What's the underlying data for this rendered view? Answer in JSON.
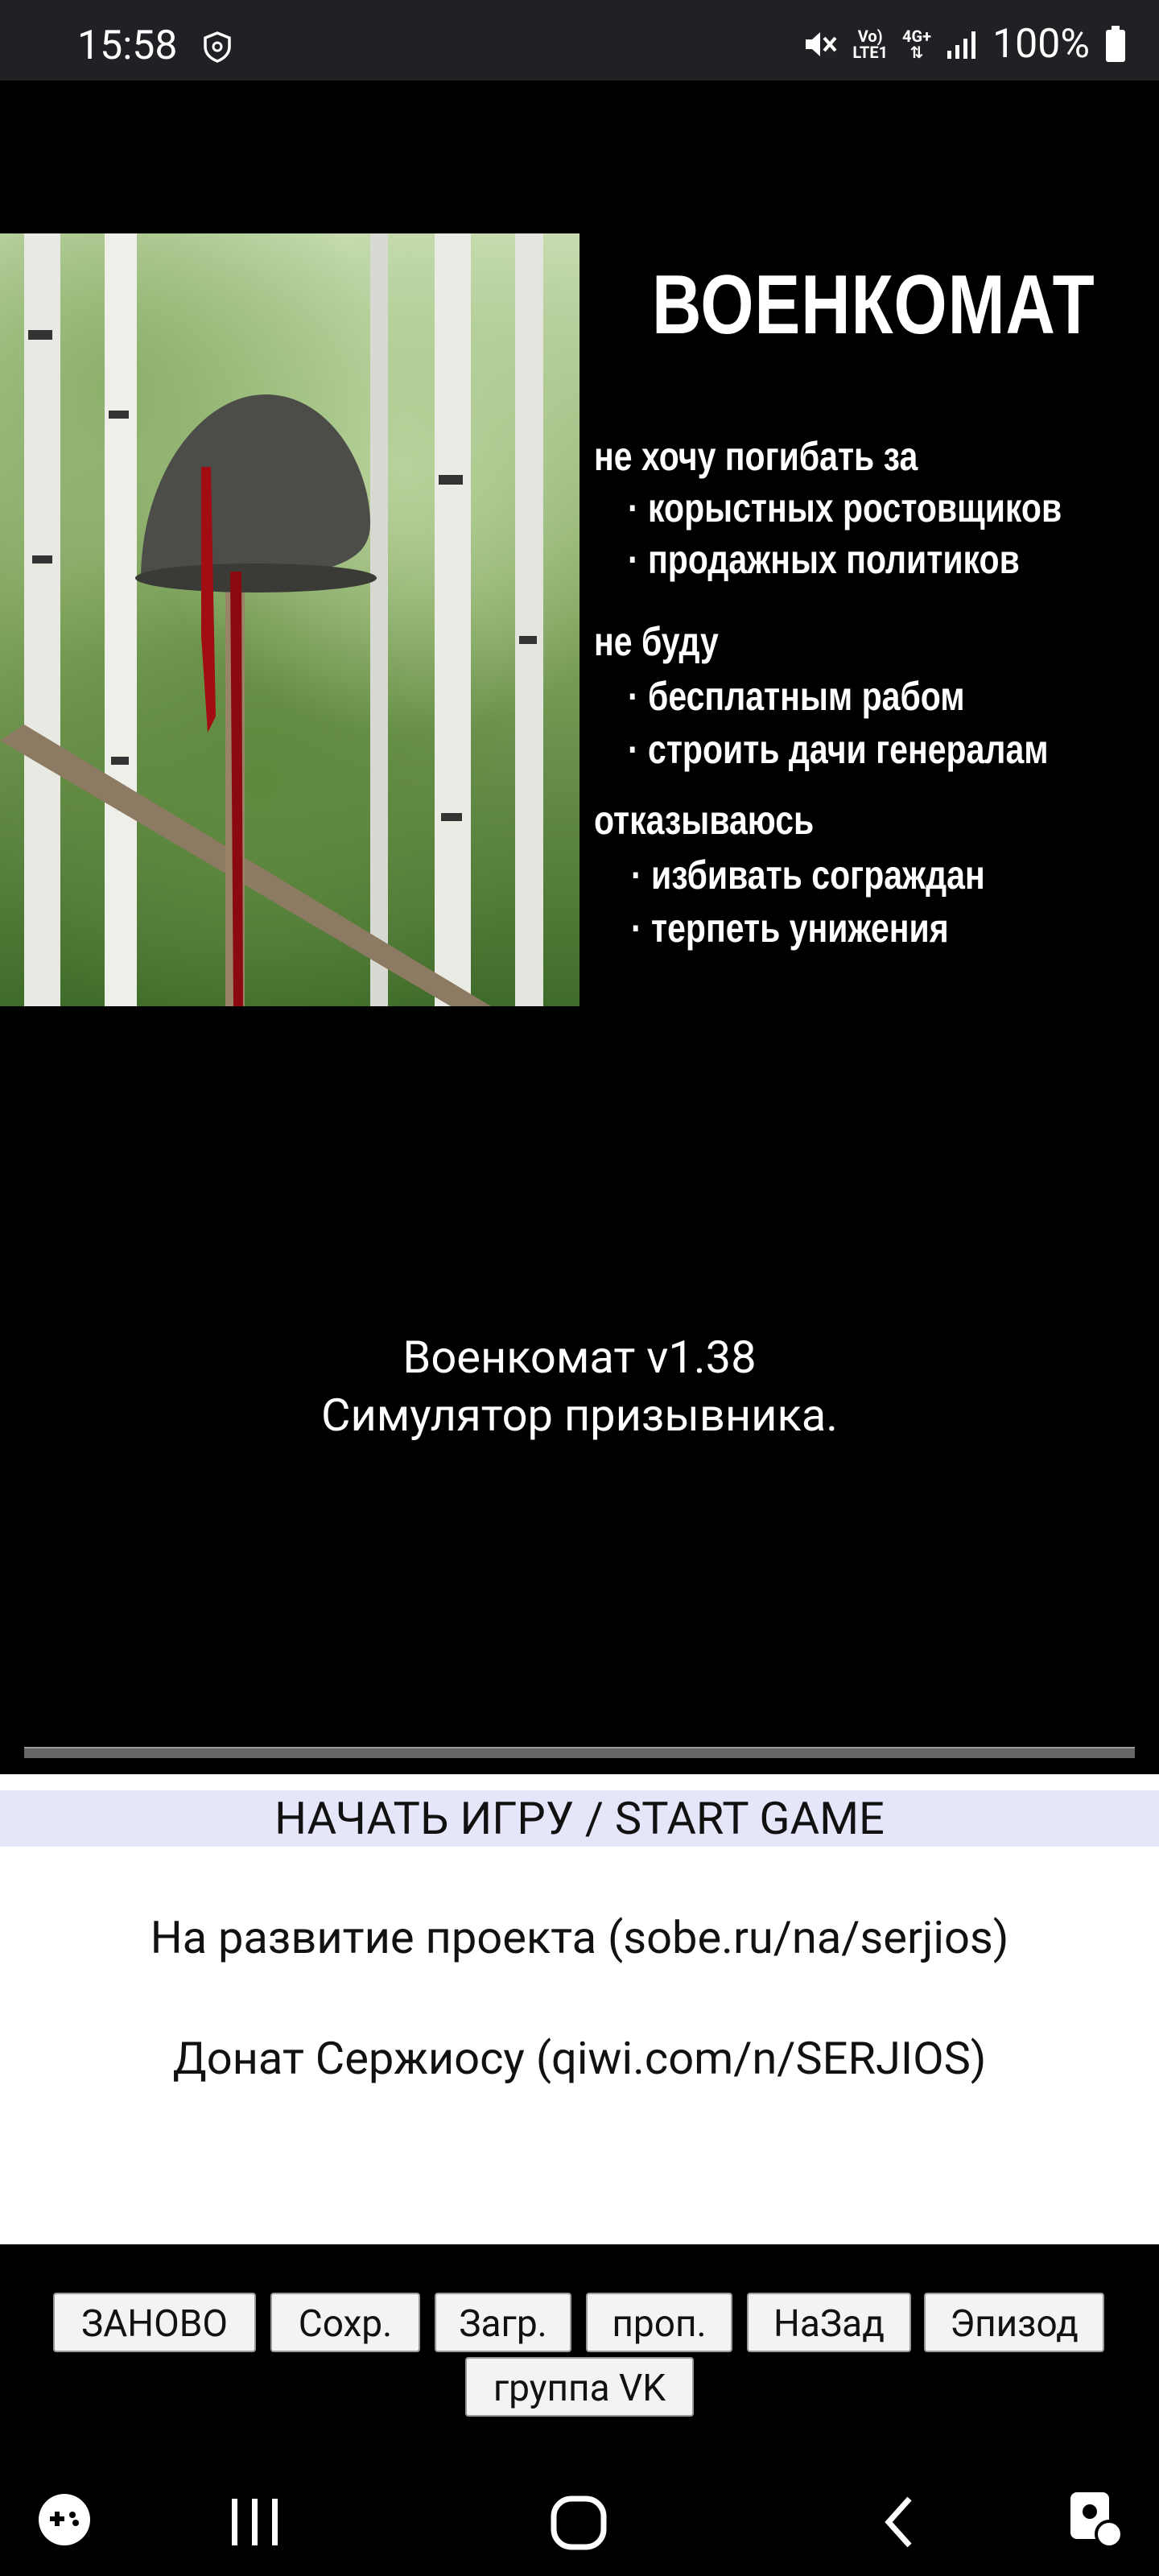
{
  "status_bar": {
    "time": "15:58",
    "network_top": "Vo)",
    "network_bottom": "LTE1",
    "net_type": "4G+",
    "battery": "100%"
  },
  "poster": {
    "title": "ВОЕНКОМАТ",
    "lines": [
      "не хочу погибать за",
      "· корыстных ростовщиков",
      "· продажных политиков",
      "не буду",
      "· бесплатным рабом",
      "· строить дачи генералам",
      "отказываюсь",
      "· избивать сограждан",
      "· терпеть унижения"
    ]
  },
  "game": {
    "version_line1": "Военкомат v1.38",
    "version_line2": "Симулятор призывника."
  },
  "menu": {
    "start": "НАЧАТЬ ИГРУ / START GAME",
    "donate_project": "На развитие проекта (sobe.ru/na/serjios)",
    "donate_serjios": "Донат Сержиосу (qiwi.com/n/SERJIOS)"
  },
  "toolbar": {
    "restart": "ЗАНОВО",
    "save": "Сохр.",
    "load": "Загр.",
    "skip": "проп.",
    "back": "НаЗад",
    "episodes": "Эпизод",
    "vk": "группа VK"
  }
}
